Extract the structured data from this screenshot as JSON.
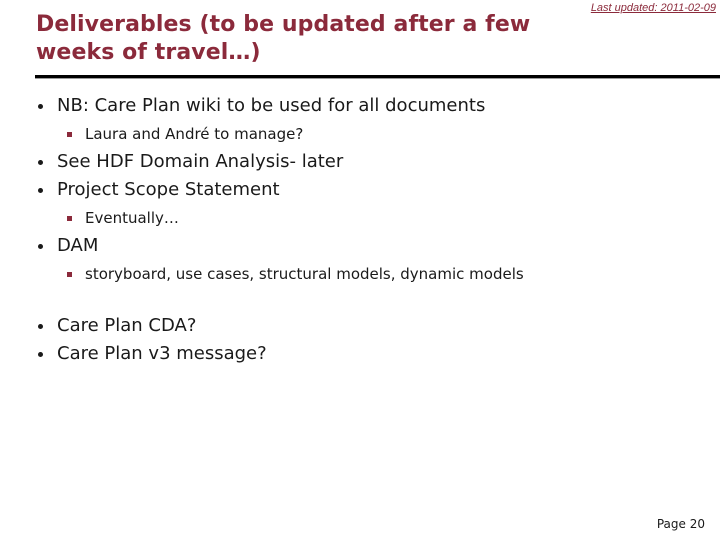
{
  "slide": {
    "title": "Deliverables (to be updated after a few weeks of travel…)",
    "last_updated": "Last updated: 2011-02-09",
    "page_number": "Page 20"
  },
  "bullets": [
    {
      "text": "NB: Care Plan wiki to be used for all documents",
      "children": [
        {
          "text": "Laura and André to manage?"
        }
      ]
    },
    {
      "text": "See HDF Domain Analysis- later",
      "children": []
    },
    {
      "text": "Project Scope Statement",
      "children": [
        {
          "text": "Eventually…"
        }
      ]
    },
    {
      "text": "DAM",
      "children": [
        {
          "text": "storyboard, use cases, structural models, dynamic models"
        }
      ]
    },
    {
      "text": "Care Plan CDA?",
      "children": []
    },
    {
      "text": "Care Plan v3 message?",
      "children": []
    }
  ],
  "colors": {
    "accent": "#8b2a3b",
    "text": "#1a1a1a",
    "rule": "#000000"
  },
  "icons": {
    "bullet": "bullet-dot-icon",
    "sub_bullet": "square-bullet-icon"
  }
}
